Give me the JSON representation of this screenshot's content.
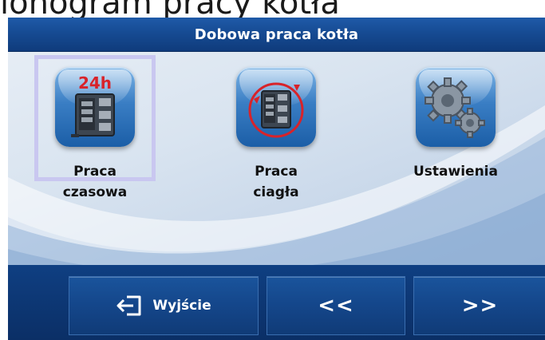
{
  "caption": "lonogram pracy kotła",
  "header": {
    "title": "Dobowa praca kotła"
  },
  "menu": [
    {
      "id": "time",
      "label": "Praca czasowa",
      "badge": "24h",
      "icon": "boiler-clock-icon",
      "selected": true
    },
    {
      "id": "continuous",
      "label": "Praca ciagła",
      "icon": "boiler-cycle-icon",
      "selected": false
    },
    {
      "id": "settings",
      "label": "Ustawienia",
      "icon": "gears-icon",
      "selected": false
    }
  ],
  "footer": {
    "exit_label": "Wyjście",
    "prev_label": "<<",
    "next_label": ">>"
  },
  "colors": {
    "title_bar": "#164b93",
    "selection_frame": "#c9c7f0",
    "badge_red": "#d8232a"
  }
}
